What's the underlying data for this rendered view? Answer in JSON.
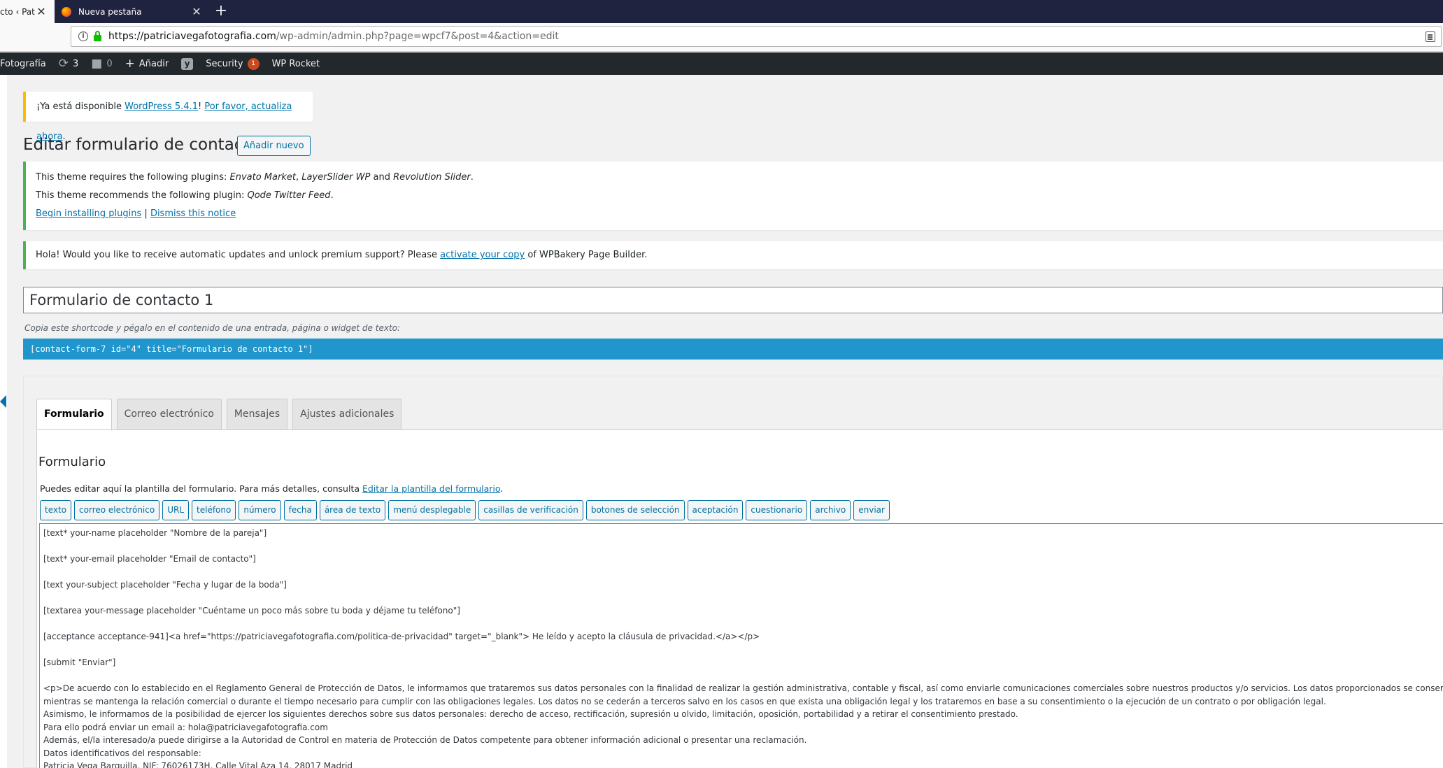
{
  "browser": {
    "active_tab_title": "cto ‹ Patr",
    "inactive_tab_title": "Nueva pestaña",
    "new_tab_symbol": "+",
    "url_host": "https://patriciavegafotografia.com",
    "url_path": "/wp-admin/admin.php?page=wpcf7&post=4&action=edit"
  },
  "adminbar": {
    "site_name": "Fotografía",
    "updates_count": "3",
    "comments_count": "0",
    "add_new_label": "Añadir",
    "yoast_label": "y",
    "security_label": "Security",
    "security_badge": "1",
    "wp_rocket_label": "WP Rocket"
  },
  "update_nag": {
    "prefix": "¡Ya está disponible ",
    "version_link": "WordPress 5.4.1",
    "middle": "! ",
    "update_link": "Por favor, actualiza ahora",
    "suffix": "."
  },
  "page": {
    "title": "Editar formulario de contacto",
    "add_new_button": "Añadir nuevo"
  },
  "notice_tgm": {
    "line1_prefix": "This theme requires the following plugins: ",
    "plugin1": "Envato Market",
    "sep1": ", ",
    "plugin2": "LayerSlider WP",
    "and": " and ",
    "plugin3": "Revolution Slider",
    "line1_suffix": ".",
    "line2_prefix": "This theme recommends the following plugin: ",
    "plugin4": "Qode Twitter Feed",
    "line2_suffix": ".",
    "begin_link": "Begin installing plugins",
    "pipe": " | ",
    "dismiss_link": "Dismiss this notice"
  },
  "notice_wpb": {
    "prefix": "Hola! Would you like to receive automatic updates and unlock premium support? Please ",
    "link": "activate your copy",
    "suffix": " of WPBakery Page Builder."
  },
  "form": {
    "title_value": "Formulario de contacto 1",
    "shortcode_desc": "Copia este shortcode y pégalo en el contenido de una entrada, página o widget de texto:",
    "shortcode": "[contact-form-7 id=\"4\" title=\"Formulario de contacto 1\"]"
  },
  "tabs": [
    "Formulario",
    "Correo electrónico",
    "Mensajes",
    "Ajustes adicionales"
  ],
  "panel": {
    "heading": "Formulario",
    "desc_prefix": "Puedes editar aquí la plantilla del formulario. Para más detalles, consulta ",
    "desc_link": "Editar la plantilla del formulario",
    "desc_suffix": "."
  },
  "tag_buttons": [
    "texto",
    "correo electrónico",
    "URL",
    "teléfono",
    "número",
    "fecha",
    "área de texto",
    "menú desplegable",
    "casillas de verificación",
    "botones de selección",
    "aceptación",
    "cuestionario",
    "archivo",
    "enviar"
  ],
  "code_lines": [
    "[text* your-name placeholder \"Nombre de la pareja\"]",
    "",
    "[text* your-email placeholder \"Email de contacto\"]",
    "",
    "[text your-subject placeholder \"Fecha y lugar de la boda\"]",
    "",
    "[textarea your-message placeholder \"Cuéntame un poco más sobre tu boda y déjame tu teléfono\"]",
    "",
    "[acceptance acceptance-941]<a href=\"https://patriciavegafotografia.com/politica-de-privacidad\" target=\"_blank\"> He leído y acepto la cláusula de privacidad.</a></p>",
    "",
    "[submit \"Enviar\"]",
    "",
    "<p>De acuerdo con lo establecido en el Reglamento General de Protección de Datos, le informamos que trataremos sus datos personales con la finalidad de realizar la gestión administrativa, contable y fiscal, así como enviarle comunicaciones comerciales sobre nuestros productos y/o servicios. Los datos proporcionados se conservarán",
    "mientras se mantenga la relación comercial o durante el tiempo necesario para cumplir con las obligaciones legales. Los datos no se cederán a terceros salvo en los casos en que exista una obligación legal y los trataremos en base a su consentimiento o la ejecución de un contrato o por obligación legal.",
    "Asimismo, le informamos de la posibilidad de ejercer los siguientes derechos sobre sus datos personales: derecho de acceso, rectificación, supresión u olvido, limitación, oposición, portabilidad y a retirar el consentimiento prestado.",
    "Para ello podrá enviar un email a: hola@patriciavegafotografia.com",
    "Además, el/la interesado/a puede dirigirse a la Autoridad de Control en materia de Protección de Datos competente para obtener información adicional o presentar una reclamación.",
    "Datos identificativos del responsable:",
    "Patricia Vega Barquilla, NIF: 76026173H, Calle Vital Aza 14, 28017 Madrid"
  ]
}
